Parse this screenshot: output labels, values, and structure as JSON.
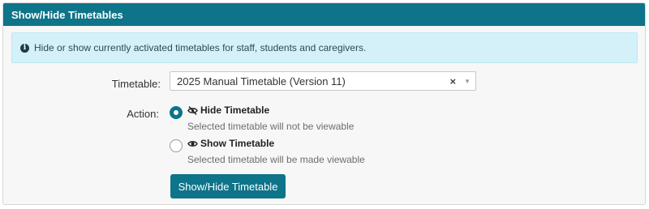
{
  "panel": {
    "title": "Show/Hide Timetables"
  },
  "alert": {
    "icon": "info-icon",
    "text": "Hide or show currently activated timetables for staff, students and caregivers."
  },
  "form": {
    "timetable_label": "Timetable:",
    "timetable_value": "2025 Manual Timetable (Version 11)",
    "clear_glyph": "×",
    "action_label": "Action:",
    "options": [
      {
        "title": "Hide Timetable",
        "description": "Selected timetable will not be viewable",
        "icon": "eye-slash-icon",
        "checked": true
      },
      {
        "title": "Show Timetable",
        "description": "Selected timetable will be made viewable",
        "icon": "eye-icon",
        "checked": false
      }
    ],
    "submit_label": "Show/Hide Timetable"
  },
  "colors": {
    "header": "#0e7489",
    "alert_bg": "#d4f1f9",
    "button": "#0e7489"
  }
}
